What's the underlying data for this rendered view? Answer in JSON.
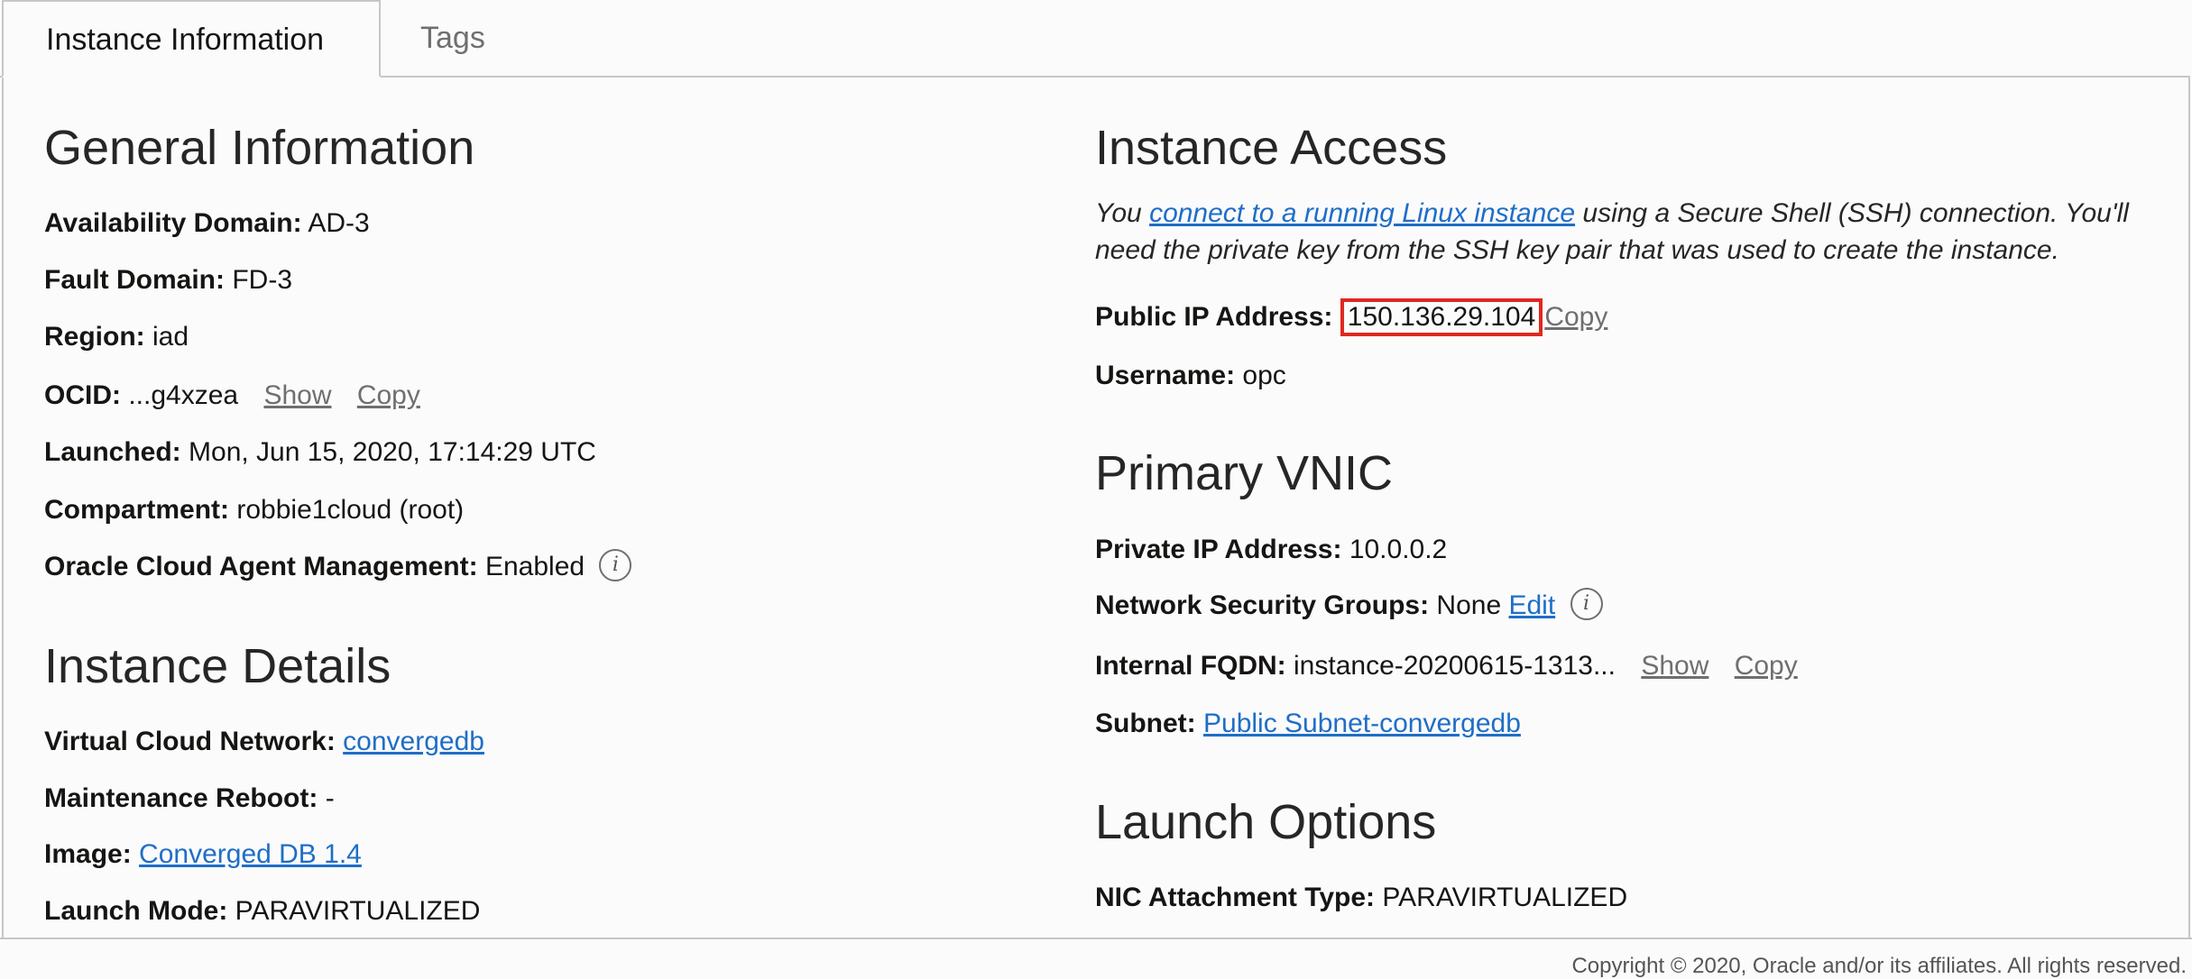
{
  "tabs": {
    "instance_information": "Instance Information",
    "tags": "Tags"
  },
  "general": {
    "heading": "General Information",
    "availability_domain": {
      "label": "Availability Domain:",
      "value": "AD-3"
    },
    "fault_domain": {
      "label": "Fault Domain:",
      "value": "FD-3"
    },
    "region": {
      "label": "Region:",
      "value": "iad"
    },
    "ocid": {
      "label": "OCID:",
      "value": "...g4xzea",
      "show": "Show",
      "copy": "Copy"
    },
    "launched": {
      "label": "Launched:",
      "value": "Mon, Jun 15, 2020, 17:14:29 UTC"
    },
    "compartment": {
      "label": "Compartment:",
      "value": "robbie1cloud (root)"
    },
    "agent": {
      "label": "Oracle Cloud Agent Management:",
      "value": "Enabled"
    }
  },
  "details": {
    "heading": "Instance Details",
    "vcn": {
      "label": "Virtual Cloud Network:",
      "value": "convergedb"
    },
    "maintenance": {
      "label": "Maintenance Reboot:",
      "value": "-"
    },
    "image": {
      "label": "Image:",
      "value": "Converged DB 1.4"
    },
    "launch_mode": {
      "label": "Launch Mode:",
      "value": "PARAVIRTUALIZED"
    }
  },
  "access": {
    "heading": "Instance Access",
    "desc_before": "You ",
    "desc_link": "connect to a running Linux instance",
    "desc_after": " using a Secure Shell (SSH) connection. You'll need the private key from the SSH key pair that was used to create the instance.",
    "public_ip": {
      "label": "Public IP Address:",
      "value": "150.136.29.104",
      "copy": "Copy"
    },
    "username": {
      "label": "Username:",
      "value": "opc"
    }
  },
  "vnic": {
    "heading": "Primary VNIC",
    "private_ip": {
      "label": "Private IP Address:",
      "value": "10.0.0.2"
    },
    "nsg": {
      "label": "Network Security Groups:",
      "value": "None",
      "edit": "Edit"
    },
    "fqdn": {
      "label": "Internal FQDN:",
      "value": "instance-20200615-1313...",
      "show": "Show",
      "copy": "Copy"
    },
    "subnet": {
      "label": "Subnet:",
      "value": "Public Subnet-convergedb"
    }
  },
  "launch": {
    "heading": "Launch Options",
    "nic": {
      "label": "NIC Attachment Type:",
      "value": "PARAVIRTUALIZED"
    }
  },
  "info_icon_glyph": "i",
  "footer": {
    "copyright": "Copyright © 2020, Oracle and/or its affiliates. All rights reserved."
  },
  "colors": {
    "link": "#1f6ec6",
    "highlight": "#e0281e",
    "muted": "#6f6f6f"
  }
}
